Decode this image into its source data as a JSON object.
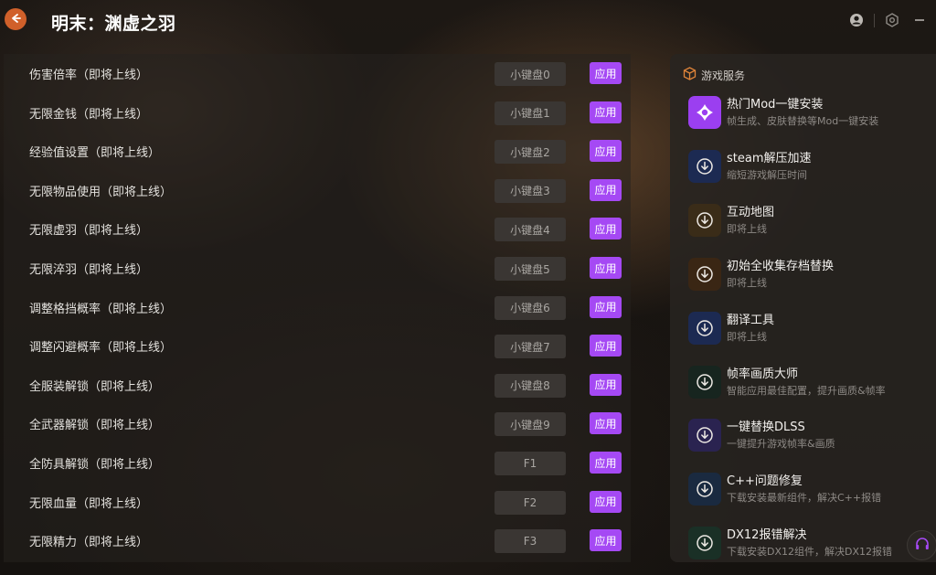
{
  "header": {
    "title": "明末：渊虚之羽",
    "back_icon": "back-arrow-icon",
    "user_icon": "user-icon",
    "settings_icon": "settings-icon",
    "minimize_icon": "minimize-icon",
    "accent": "#d0602a"
  },
  "cheats": {
    "apply_color": "#a549f4",
    "rows": [
      {
        "label": "伤害倍率（即将上线）",
        "key": "小键盘0",
        "apply": "应用"
      },
      {
        "label": "无限金钱（即将上线）",
        "key": "小键盘1",
        "apply": "应用"
      },
      {
        "label": "经验值设置（即将上线）",
        "key": "小键盘2",
        "apply": "应用"
      },
      {
        "label": "无限物品使用（即将上线）",
        "key": "小键盘3",
        "apply": "应用"
      },
      {
        "label": "无限虚羽（即将上线）",
        "key": "小键盘4",
        "apply": "应用"
      },
      {
        "label": "无限淬羽（即将上线）",
        "key": "小键盘5",
        "apply": "应用"
      },
      {
        "label": "调整格挡概率（即将上线）",
        "key": "小键盘6",
        "apply": "应用"
      },
      {
        "label": "调整闪避概率（即将上线）",
        "key": "小键盘7",
        "apply": "应用"
      },
      {
        "label": "全服装解锁（即将上线）",
        "key": "小键盘8",
        "apply": "应用"
      },
      {
        "label": "全武器解锁（即将上线）",
        "key": "小键盘9",
        "apply": "应用"
      },
      {
        "label": "全防具解锁（即将上线）",
        "key": "F1",
        "apply": "应用"
      },
      {
        "label": "无限血量（即将上线）",
        "key": "F2",
        "apply": "应用"
      },
      {
        "label": "无限精力（即将上线）",
        "key": "F3",
        "apply": "应用"
      }
    ]
  },
  "services": {
    "header_label": "游戏服务",
    "header_icon": "box-icon",
    "items": [
      {
        "name": "热门Mod一键安装",
        "desc": "帧生成、皮肤替换等Mod一键安装",
        "icon": "mod-icon",
        "color": "#9b3ff0"
      },
      {
        "name": "steam解压加速",
        "desc": "缩短游戏解压时间",
        "icon": "download-icon",
        "color": "#1c2a52"
      },
      {
        "name": "互动地图",
        "desc": "即将上线",
        "icon": "download-icon",
        "color": "#3a2c18"
      },
      {
        "name": "初始全收集存档替换",
        "desc": "即将上线",
        "icon": "download-icon",
        "color": "#3a2614"
      },
      {
        "name": "翻译工具",
        "desc": "即将上线",
        "icon": "download-icon",
        "color": "#1c2a52"
      },
      {
        "name": "帧率画质大师",
        "desc": "智能应用最佳配置，提升画质&帧率",
        "icon": "download-icon",
        "color": "#17251f"
      },
      {
        "name": "一键替换DLSS",
        "desc": "一键提升游戏帧率&画质",
        "icon": "download-icon",
        "color": "#2a2350"
      },
      {
        "name": "C++问题修复",
        "desc": "下载安装最新组件，解决C++报错",
        "icon": "download-icon",
        "color": "#1a2a40"
      },
      {
        "name": "DX12报错解决",
        "desc": "下载安装DX12组件，解决DX12报错",
        "icon": "download-icon",
        "color": "#1a3026"
      }
    ]
  },
  "support": {
    "icon": "headset-icon",
    "color": "#a549f4"
  }
}
